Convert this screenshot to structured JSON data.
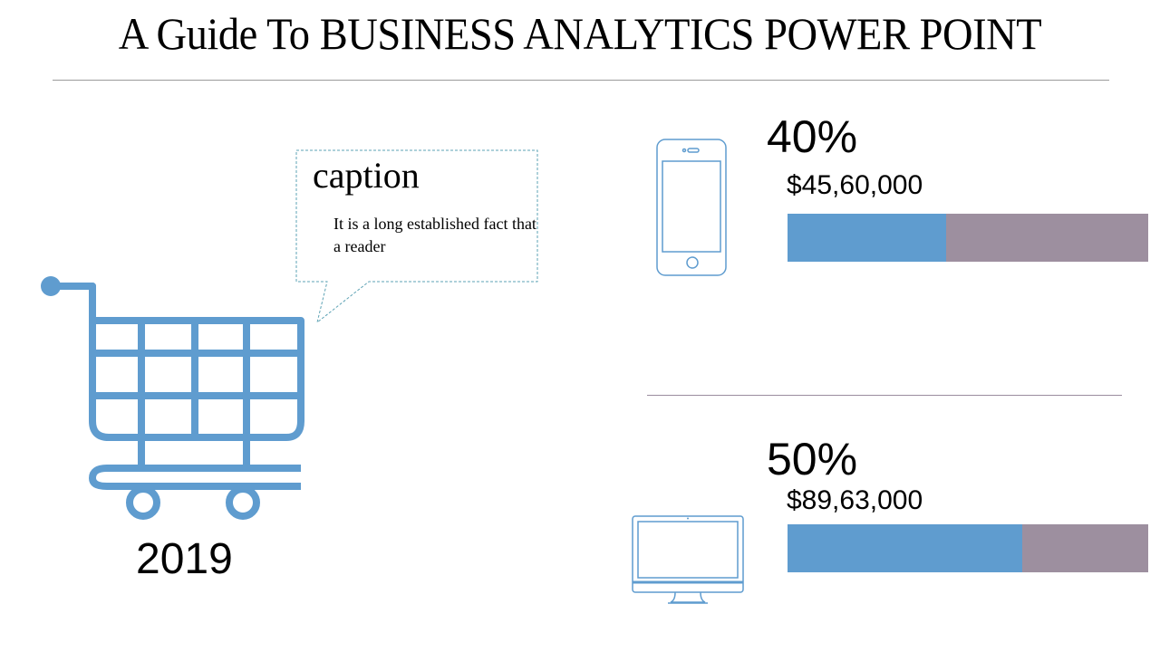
{
  "slide": {
    "title": "A Guide To BUSINESS ANALYTICS POWER POINT",
    "caption": {
      "heading": "caption",
      "body": "It is a long established fact that a reader"
    },
    "cart": {
      "icon": "shopping-cart-icon",
      "year": "2019"
    },
    "metrics": [
      {
        "icon": "smartphone-icon",
        "percent_label": "40%",
        "amount": "$45,60,000",
        "bar_fill_fraction": 0.44
      },
      {
        "icon": "desktop-monitor-icon",
        "percent_label": "50%",
        "amount": "$89,63,000",
        "bar_fill_fraction": 0.65
      }
    ],
    "colors": {
      "accent_blue": "#5f9ccf",
      "bar_remainder": "#9d8f9f",
      "callout_border": "#5ea3b5",
      "rule": "#9b9b9b"
    }
  }
}
